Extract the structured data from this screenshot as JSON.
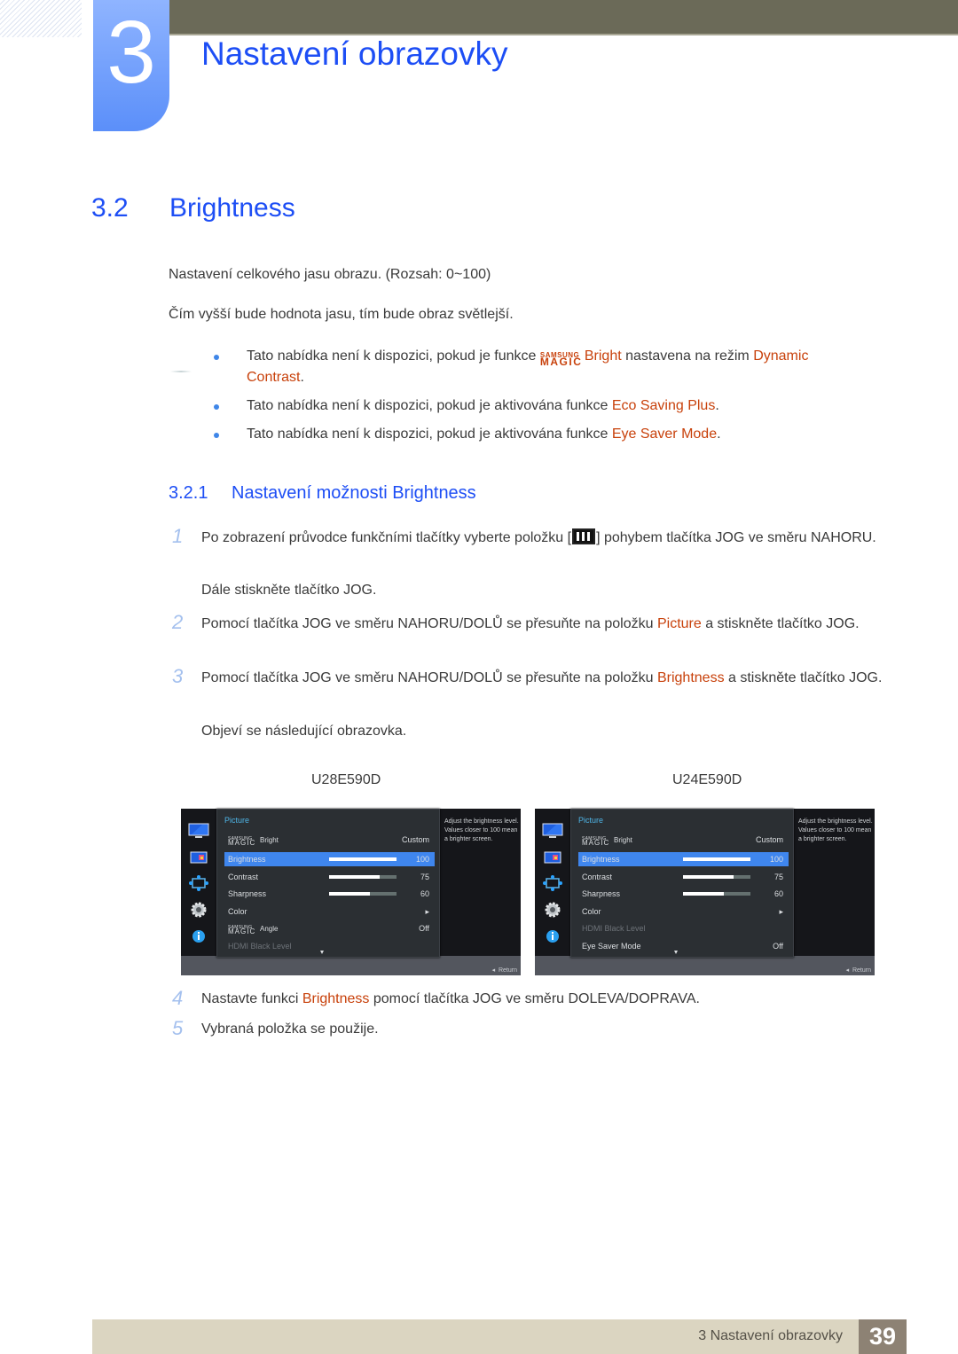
{
  "header": {
    "chapter_number": "3",
    "chapter_title": "Nastavení obrazovky"
  },
  "section": {
    "number": "3.2",
    "title": "Brightness"
  },
  "intro": [
    "Nastavení celkového jasu obrazu. (Rozsah: 0~100)",
    "Čím vyšší bude hodnota jasu, tím bude obraz světlejší."
  ],
  "notes": [
    {
      "prefix": "Tato nabídka není k dispozici, pokud je funkce ",
      "magic_top": "SAMSUNG",
      "magic_bottom": "MAGIC",
      "magic_name": "Bright",
      "middle": " nastavena na režim ",
      "highlight": "Dynamic Contrast",
      "suffix": "."
    },
    {
      "prefix": "Tato nabídka není k dispozici, pokud je aktivována funkce ",
      "highlight": "Eco Saving Plus",
      "suffix": "."
    },
    {
      "prefix": "Tato nabídka není k dispozici, pokud je aktivována funkce ",
      "highlight": "Eye Saver Mode",
      "suffix": "."
    }
  ],
  "subsection": {
    "number": "3.2.1",
    "title": "Nastavení možnosti Brightness"
  },
  "steps": [
    {
      "num": "1",
      "text_a": "Po zobrazení průvodce funkčními tlačítky vyberte položku [",
      "icon": "menu-icon",
      "text_b": "] pohybem tlačítka JOG ve směru NAHORU.",
      "extra": "Dále stiskněte tlačítko JOG."
    },
    {
      "num": "2",
      "text_a": "Pomocí tlačítka JOG ve směru NAHORU/DOLŮ se přesuňte na položku ",
      "highlight": "Picture",
      "text_b": " a stiskněte tlačítko JOG."
    },
    {
      "num": "3",
      "text_a": "Pomocí tlačítka JOG ve směru NAHORU/DOLŮ se přesuňte na položku ",
      "highlight": "Brightness",
      "text_b": " a stiskněte tlačítko JOG.",
      "extra": "Objeví se následující obrazovka."
    },
    {
      "num": "4",
      "text_a": "Nastavte funkci ",
      "highlight": "Brightness",
      "text_b": " pomocí tlačítka JOG ve směru DOLEVA/DOPRAVA."
    },
    {
      "num": "5",
      "text_a": "Vybraná položka se použije."
    }
  ],
  "osd_screens": [
    {
      "model": "U28E590D",
      "category": "Picture",
      "side_icons": [
        "picture-icon",
        "color-icon",
        "size-position-icon",
        "setup-icon",
        "info-icon"
      ],
      "help": "Adjust the brightness level. Values closer to 100 mean a brighter screen.",
      "return_label": "Return",
      "rows": [
        {
          "label": "Bright",
          "magic": true,
          "magic_top": "SAMSUNG",
          "magic_bottom": "MAGIC",
          "value": "Custom"
        },
        {
          "label": "Brightness",
          "value": "100",
          "bar": 100,
          "selected": true
        },
        {
          "label": "Contrast",
          "value": "75",
          "bar": 75
        },
        {
          "label": "Sharpness",
          "value": "60",
          "bar": 60
        },
        {
          "label": "Color",
          "value": "▸"
        },
        {
          "label": "Angle",
          "magic": true,
          "magic_top": "SAMSUNG",
          "magic_bottom": "MAGIC",
          "value": "Off"
        },
        {
          "label": "HDMI Black Level",
          "value": "",
          "dim": true
        }
      ]
    },
    {
      "model": "U24E590D",
      "category": "Picture",
      "side_icons": [
        "picture-icon",
        "color-icon",
        "size-position-icon",
        "setup-icon",
        "info-icon"
      ],
      "help": "Adjust the brightness level. Values closer to 100 mean a brighter screen.",
      "return_label": "Return",
      "rows": [
        {
          "label": "Bright",
          "magic": true,
          "magic_top": "SAMSUNG",
          "magic_bottom": "MAGIC",
          "value": "Custom"
        },
        {
          "label": "Brightness",
          "value": "100",
          "bar": 100,
          "selected": true
        },
        {
          "label": "Contrast",
          "value": "75",
          "bar": 75
        },
        {
          "label": "Sharpness",
          "value": "60",
          "bar": 60
        },
        {
          "label": "Color",
          "value": "▸"
        },
        {
          "label": "HDMI Black Level",
          "value": "",
          "dim": true
        },
        {
          "label": "Eye Saver Mode",
          "value": "Off"
        }
      ]
    }
  ],
  "footer": {
    "chapter_label": "3 Nastavení obrazovky",
    "page_number": "39"
  },
  "colors": {
    "heading_blue": "#1d4ef5",
    "highlight_orange": "#c8410b",
    "osd_selected": "#3f86ee",
    "osd_category": "#4fb6e8"
  }
}
